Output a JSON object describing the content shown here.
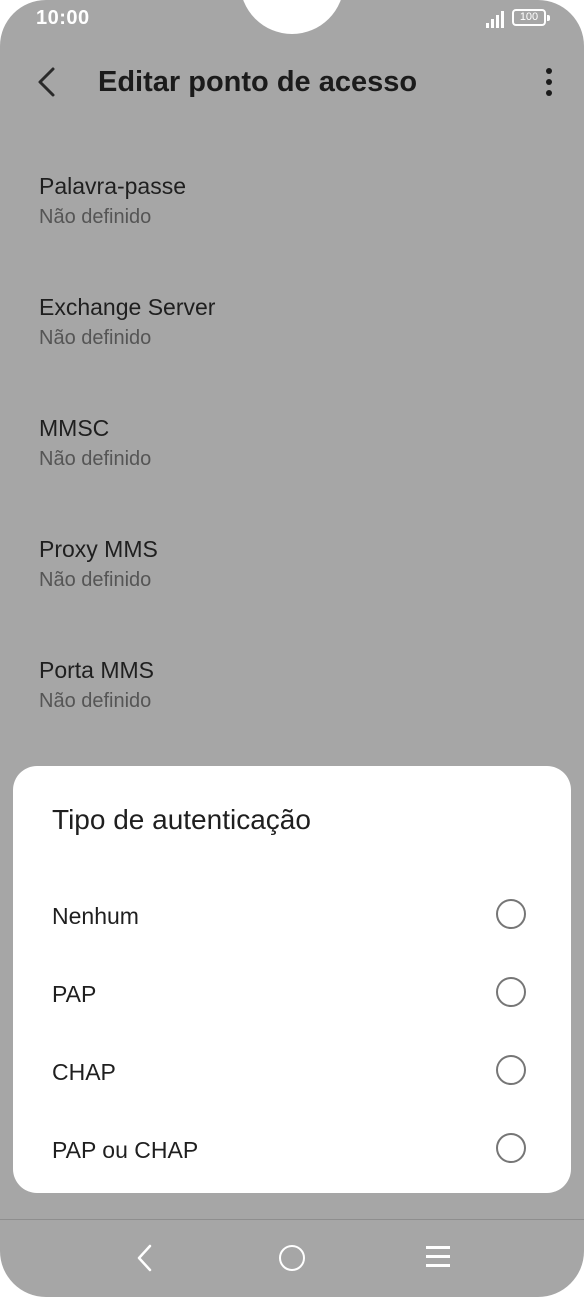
{
  "status_bar": {
    "time": "10:00",
    "battery": "100"
  },
  "app_bar": {
    "title": "Editar ponto de acesso",
    "back_icon": "chevron-left-icon",
    "more_icon": "more-vertical-icon"
  },
  "settings": [
    {
      "label": "Palavra-passe",
      "value": "Não definido"
    },
    {
      "label": "Exchange Server",
      "value": "Não definido"
    },
    {
      "label": "MMSC",
      "value": "Não definido"
    },
    {
      "label": "Proxy MMS",
      "value": "Não definido"
    },
    {
      "label": "Porta MMS",
      "value": "Não definido"
    }
  ],
  "dialog": {
    "title": "Tipo de autenticação",
    "options": [
      {
        "label": "Nenhum",
        "selected": false
      },
      {
        "label": "PAP",
        "selected": false
      },
      {
        "label": "CHAP",
        "selected": false
      },
      {
        "label": "PAP ou CHAP",
        "selected": false
      }
    ]
  },
  "nav_bar": {
    "back_icon": "back-icon",
    "home_icon": "home-icon",
    "menu_icon": "menu-icon"
  },
  "colors": {
    "scrim": "#a6a6a6",
    "dialog_bg": "#ffffff",
    "radio": "#767676",
    "text": "#1f1f1f"
  }
}
